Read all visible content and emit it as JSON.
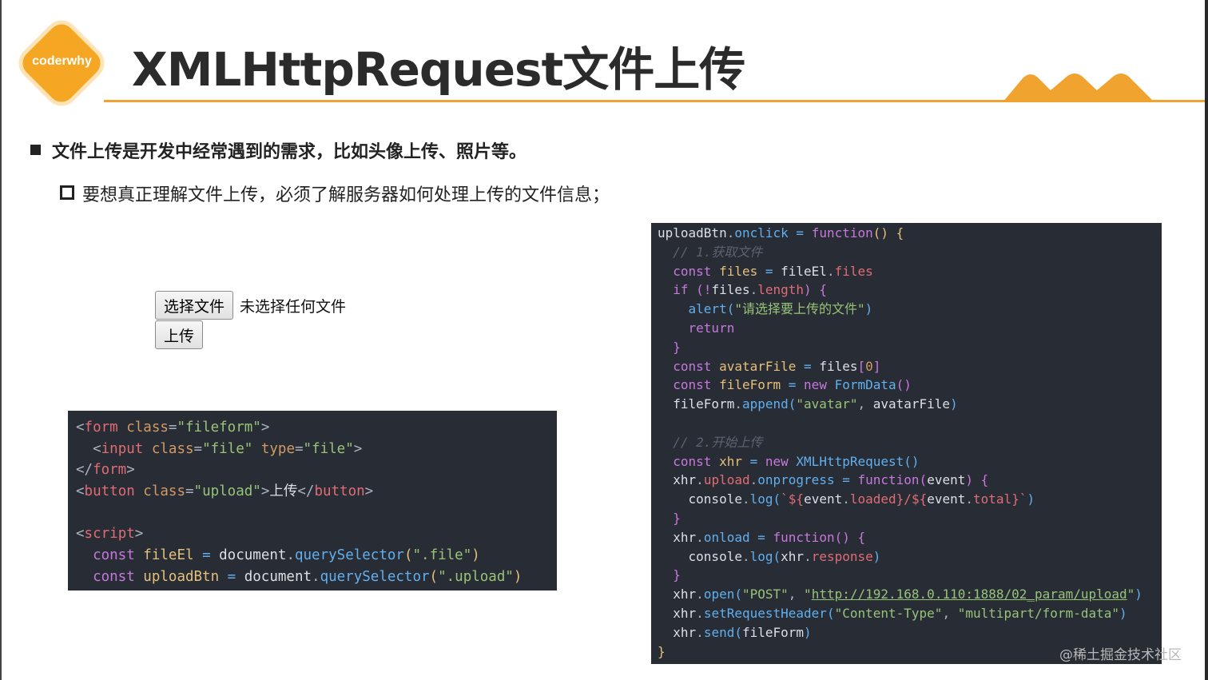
{
  "logo": {
    "text": "coderwhy"
  },
  "title": "XMLHttpRequest文件上传",
  "bullets": {
    "level1": "文件上传是开发中经常遇到的需求，比如头像上传、照片等。",
    "level2": "要想真正理解文件上传，必须了解服务器如何处理上传的文件信息；"
  },
  "file_widget": {
    "choose_label": "选择文件",
    "no_file_text": "未选择任何文件",
    "upload_label": "上传"
  },
  "code_html": {
    "l1": {
      "lt": "<",
      "tag": "form",
      "attr": " class",
      "eq": "=",
      "str": "\"fileform\"",
      "gt": ">"
    },
    "l2": {
      "lt": "<",
      "tag": "input",
      "attr1": " class",
      "eq1": "=",
      "str1": "\"file\"",
      "attr2": " type",
      "eq2": "=",
      "str2": "\"file\"",
      "gt": ">"
    },
    "l3": {
      "lt": "</",
      "tag": "form",
      "gt": ">"
    },
    "l4": {
      "lt": "<",
      "tag": "button",
      "attr": " class",
      "eq": "=",
      "str": "\"upload\"",
      "gt": ">",
      "text": "上传",
      "lt2": "</",
      "tag2": "button",
      "gt2": ">"
    },
    "l6": {
      "lt": "<",
      "tag": "script",
      "gt": ">"
    },
    "l7": {
      "kw": "const",
      "var": " fileEl",
      "op": " = ",
      "obj": "document",
      "dot": ".",
      "fn": "querySelector",
      "open": "(",
      "str": "\".file\"",
      "close": ")"
    },
    "l8": {
      "kw": "const",
      "var": " uploadBtn",
      "op": " = ",
      "obj": "document",
      "dot": ".",
      "fn": "querySelector",
      "open": "(",
      "str": "\".upload\"",
      "close": ")"
    }
  },
  "code_js": {
    "r1": [
      "uploadBtn",
      ".",
      "onclick",
      " = ",
      "function",
      "() {"
    ],
    "r2": [
      "// 1.获取文件"
    ],
    "r3": [
      "const",
      " files",
      " = ",
      "fileEl",
      ".",
      "files"
    ],
    "r4": [
      "if",
      " (!",
      "files",
      ".",
      "length",
      ") {"
    ],
    "r5": [
      "alert",
      "(",
      "\"请选择要上传的文件\"",
      ")"
    ],
    "r6": [
      "return"
    ],
    "r7": [
      "}"
    ],
    "r8": [
      "const",
      " avatarFile",
      " = ",
      "files",
      "[",
      "0",
      "]"
    ],
    "r9": [
      "const",
      " fileForm",
      " = ",
      "new",
      " FormData",
      "()"
    ],
    "r10": [
      "fileForm",
      ".",
      "append",
      "(",
      "\"avatar\"",
      ", ",
      "avatarFile",
      ")"
    ],
    "r12": [
      "// 2.开始上传"
    ],
    "r13": [
      "const",
      " xhr",
      " = ",
      "new",
      " XMLHttpRequest",
      "()"
    ],
    "r14": [
      "xhr",
      ".",
      "upload",
      ".",
      "onprogress",
      " = ",
      "function",
      "(",
      "event",
      ") {"
    ],
    "r15": [
      "console",
      ".",
      "log",
      "(",
      "`${",
      "event",
      ".",
      "loaded",
      "}/${",
      "event",
      ".",
      "total",
      "}`",
      ")"
    ],
    "r16": [
      "}"
    ],
    "r17": [
      "xhr",
      ".",
      "onload",
      " = ",
      "function",
      "() {"
    ],
    "r18": [
      "console",
      ".",
      "log",
      "(",
      "xhr",
      ".",
      "response",
      ")"
    ],
    "r19": [
      "}"
    ],
    "r20": [
      "xhr",
      ".",
      "open",
      "(",
      "\"POST\"",
      ", ",
      "\"",
      "http://192.168.0.110:1888/02_param/upload",
      "\"",
      ")"
    ],
    "r21": [
      "xhr",
      ".",
      "setRequestHeader",
      "(",
      "\"Content-Type\"",
      ", ",
      "\"multipart/form-data\"",
      ")"
    ],
    "r22": [
      "xhr",
      ".",
      "send",
      "(",
      "fileForm",
      ")"
    ],
    "r23": [
      "}"
    ]
  },
  "watermark": "@稀土掘金技术社区",
  "colors": {
    "accent": "#f0a32e",
    "code_bg": "#282c34"
  }
}
